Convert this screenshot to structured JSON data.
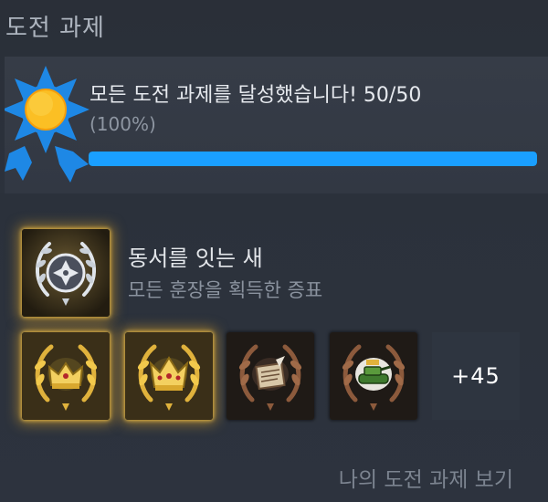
{
  "section": {
    "title": "도전 과제"
  },
  "summary": {
    "text": "모든 도전 과제를 달성했습니다! 50/50",
    "percent_text": "(100%)",
    "progress": 1.0,
    "progress_color": "#1a9fff",
    "badge_colors": {
      "star": "#1e88e5",
      "sun": "#fbbf24"
    }
  },
  "featured": {
    "name": "동서를 잇는 새",
    "description": "모든 훈장을 획득한 증표",
    "icon": "silver-laurel-emblem-icon"
  },
  "achievements": [
    {
      "icon": "gold-laurel-crown-icon",
      "rarity": "gold"
    },
    {
      "icon": "gold-laurel-crown-icon",
      "rarity": "gold"
    },
    {
      "icon": "bronze-laurel-scroll-icon",
      "rarity": "plain"
    },
    {
      "icon": "bronze-laurel-tank-icon",
      "rarity": "plain"
    }
  ],
  "more": {
    "label": "+45"
  },
  "footer": {
    "view_link": "나의 도전 과제 보기"
  }
}
